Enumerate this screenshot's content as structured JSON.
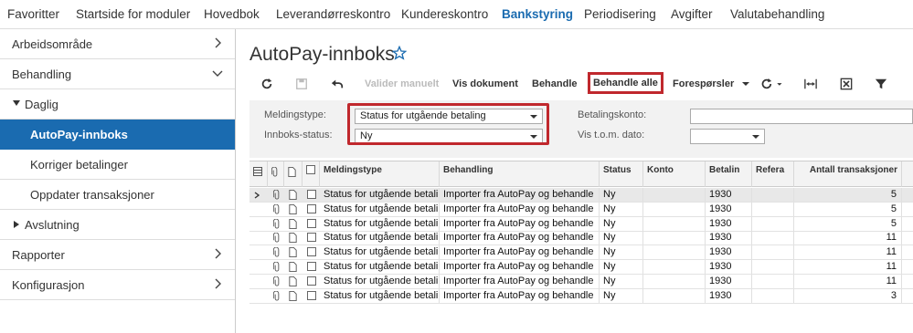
{
  "topnav": {
    "items": [
      {
        "label": "Favoritter"
      },
      {
        "label": "Startside for moduler"
      },
      {
        "label": "Hovedbok"
      },
      {
        "label": "Leverandørreskontro"
      },
      {
        "label": "Kundereskontro"
      },
      {
        "label": "Bankstyring",
        "active": true
      },
      {
        "label": "Periodisering"
      },
      {
        "label": "Avgifter"
      },
      {
        "label": "Valutabehandling"
      }
    ]
  },
  "sidebar": {
    "items": [
      {
        "label": "Arbeidsområde",
        "chevron": "chevron-right"
      },
      {
        "label": "Behandling",
        "chevron": "chevron-down"
      },
      {
        "label": "Daglig",
        "expander": "expanded"
      },
      {
        "label": "AutoPay-innboks",
        "active": true
      },
      {
        "label": "Korriger betalinger"
      },
      {
        "label": "Oppdater transaksjoner"
      },
      {
        "label": "Avslutning",
        "expander": "collapsed"
      },
      {
        "label": "Rapporter",
        "chevron": "chevron-right"
      },
      {
        "label": "Konfigurasjon",
        "chevron": "chevron-right"
      }
    ]
  },
  "page": {
    "title": "AutoPay-innboks",
    "favorite_icon": "star-outline-icon"
  },
  "toolbar": {
    "refresh_icon": "refresh-icon",
    "save_icon": "save-icon",
    "undo_icon": "undo-icon",
    "validate_label": "Valider manuelt",
    "view_doc_label": "Vis dokument",
    "process_label": "Behandle",
    "process_all_label": "Behandle alle",
    "requests_label": "Forespørsler",
    "actions_icon": "actions-refresh-icon",
    "fit_icon": "fit-width-icon",
    "excel_icon": "excel-export-icon",
    "filter_icon": "filter-icon"
  },
  "filters": {
    "message_type_label": "Meldingstype:",
    "message_type_value": "Status for utgående betaling",
    "inbox_status_label": "Innboks-status:",
    "inbox_status_value": "Ny",
    "account_label": "Betalingskonto:",
    "account_value": "",
    "date_label": "Vis t.o.m. dato:",
    "date_value": ""
  },
  "grid": {
    "columns": [
      "Meldingstype",
      "Behandling",
      "Status",
      "Konto",
      "Betalin",
      "Refera",
      "Antall transaksjoner"
    ],
    "rows": [
      {
        "type": "Status for utgående betali",
        "handling": "Importer fra AutoPay og behandle",
        "status": "Ny",
        "konto": "",
        "betaling": "1930",
        "ref": "",
        "count": "5"
      },
      {
        "type": "Status for utgående betali",
        "handling": "Importer fra AutoPay og behandle",
        "status": "Ny",
        "konto": "",
        "betaling": "1930",
        "ref": "",
        "count": "5"
      },
      {
        "type": "Status for utgående betali",
        "handling": "Importer fra AutoPay og behandle",
        "status": "Ny",
        "konto": "",
        "betaling": "1930",
        "ref": "",
        "count": "5"
      },
      {
        "type": "Status for utgående betali",
        "handling": "Importer fra AutoPay og behandle",
        "status": "Ny",
        "konto": "",
        "betaling": "1930",
        "ref": "",
        "count": "11"
      },
      {
        "type": "Status for utgående betali",
        "handling": "Importer fra AutoPay og behandle",
        "status": "Ny",
        "konto": "",
        "betaling": "1930",
        "ref": "",
        "count": "11"
      },
      {
        "type": "Status for utgående betali",
        "handling": "Importer fra AutoPay og behandle",
        "status": "Ny",
        "konto": "",
        "betaling": "1930",
        "ref": "",
        "count": "11"
      },
      {
        "type": "Status for utgående betali",
        "handling": "Importer fra AutoPay og behandle",
        "status": "Ny",
        "konto": "",
        "betaling": "1930",
        "ref": "",
        "count": "11"
      },
      {
        "type": "Status for utgående betali",
        "handling": "Importer fra AutoPay og behandle",
        "status": "Ny",
        "konto": "",
        "betaling": "1930",
        "ref": "",
        "count": "3"
      }
    ]
  },
  "colors": {
    "accent": "#1a6bb0",
    "highlight": "#c0282d"
  }
}
